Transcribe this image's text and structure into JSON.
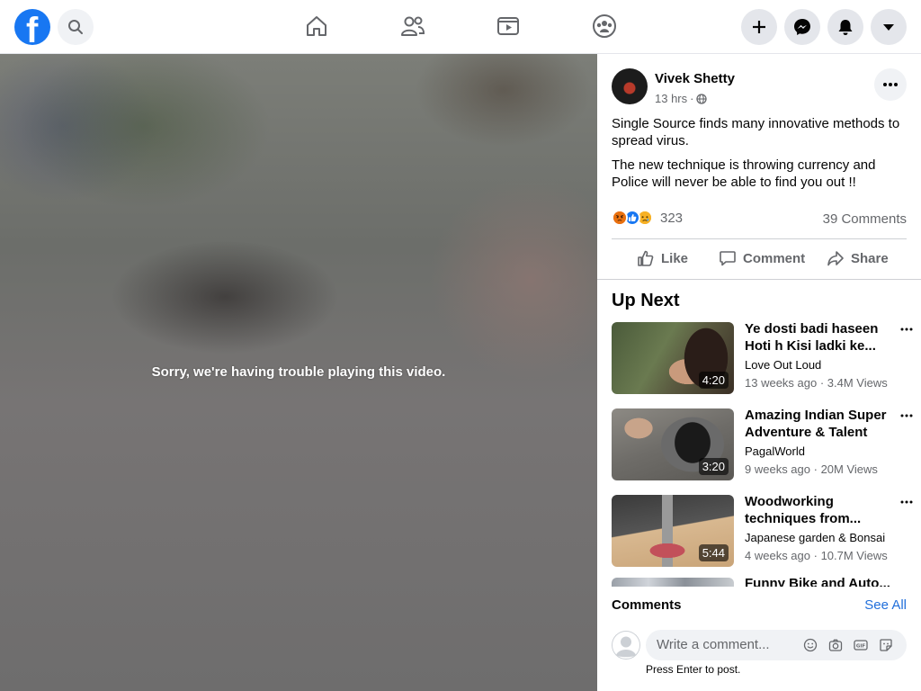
{
  "colors": {
    "brand": "#1877f2",
    "link": "#216fdb",
    "secondary_text": "#65676b"
  },
  "topbar": {
    "logo_glyph": "f",
    "nav_icons": [
      "home-icon",
      "friends-icon",
      "watch-icon",
      "groups-icon"
    ],
    "right_icons": [
      "create-icon",
      "messenger-icon",
      "notifications-icon",
      "account-menu-icon"
    ]
  },
  "video": {
    "error_message": "Sorry, we're having trouble playing this video."
  },
  "post": {
    "author": "Vivek Shetty",
    "time": "13 hrs",
    "privacy_icon": "globe-icon",
    "paragraphs": [
      "Single Source finds many innovative methods to spread virus.",
      "The new technique is throwing currency and Police will never be able to find you out !!"
    ],
    "reaction_count": "323",
    "comments_count": "39 Comments",
    "actions": {
      "like": "Like",
      "comment": "Comment",
      "share": "Share"
    }
  },
  "up_next": {
    "heading": "Up Next",
    "items": [
      {
        "title": "Ye dosti badi haseen Hoti h Kisi ladki ke...",
        "channel": "Love Out Loud",
        "age": "13 weeks ago",
        "views": "3.4M Views",
        "duration": "4:20"
      },
      {
        "title": "Amazing Indian Super Adventure & Talent",
        "channel": "PagalWorld",
        "age": "9 weeks ago",
        "views": "20M Views",
        "duration": "3:20"
      },
      {
        "title": "Woodworking techniques from...",
        "channel": "Japanese garden & Bonsai",
        "age": "4 weeks ago",
        "views": "10.7M Views",
        "duration": "5:44"
      },
      {
        "title": "Funny Bike and Auto..."
      }
    ]
  },
  "comments": {
    "heading": "Comments",
    "see_all": "See All",
    "input_placeholder": "Write a comment...",
    "hint": "Press Enter to post."
  }
}
